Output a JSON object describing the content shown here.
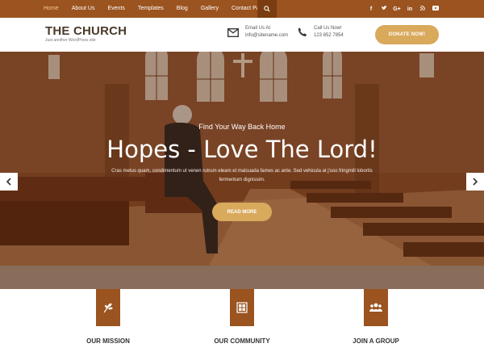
{
  "nav": {
    "items": [
      {
        "label": "Home",
        "active": true
      },
      {
        "label": "About Us",
        "active": false
      },
      {
        "label": "Events",
        "active": false
      },
      {
        "label": "Templates",
        "active": false
      },
      {
        "label": "Blog",
        "active": false
      },
      {
        "label": "Gallery",
        "active": false
      },
      {
        "label": "Contact Page",
        "active": false
      }
    ],
    "search_icon": "search-icon",
    "social_icons": [
      "facebook-icon",
      "twitter-icon",
      "google-plus-icon",
      "linkedin-icon",
      "rss-icon",
      "youtube-icon"
    ]
  },
  "header": {
    "title": "THE CHURCH",
    "tagline": "Just another WordPress site",
    "email_label": "Email Us At",
    "email_value": "info@sitename.com",
    "phone_label": "Call Us Now!",
    "phone_value": "123 852 7854",
    "donate_label": "DONATE NOW!"
  },
  "hero": {
    "kicker": "Find Your Way Back Home",
    "title": "Hopes - Love The Lord!",
    "description": "Cras metus quam, condimentum ut venen rutrum eleam et malsuada fames ac ante. Sed vehicula at j'uso fringmill lobortis fermentum dignissim.",
    "button_label": "READ MORE"
  },
  "features": [
    {
      "label": "OUR MISSION",
      "icon": "sprout-icon"
    },
    {
      "label": "OUR COMMUNITY",
      "icon": "community-tiles-icon"
    },
    {
      "label": "JOIN A GROUP",
      "icon": "group-icon"
    }
  ],
  "colors": {
    "brand": "#9b531f",
    "accent": "#d9a95c",
    "active_nav": "#f1c98f"
  }
}
